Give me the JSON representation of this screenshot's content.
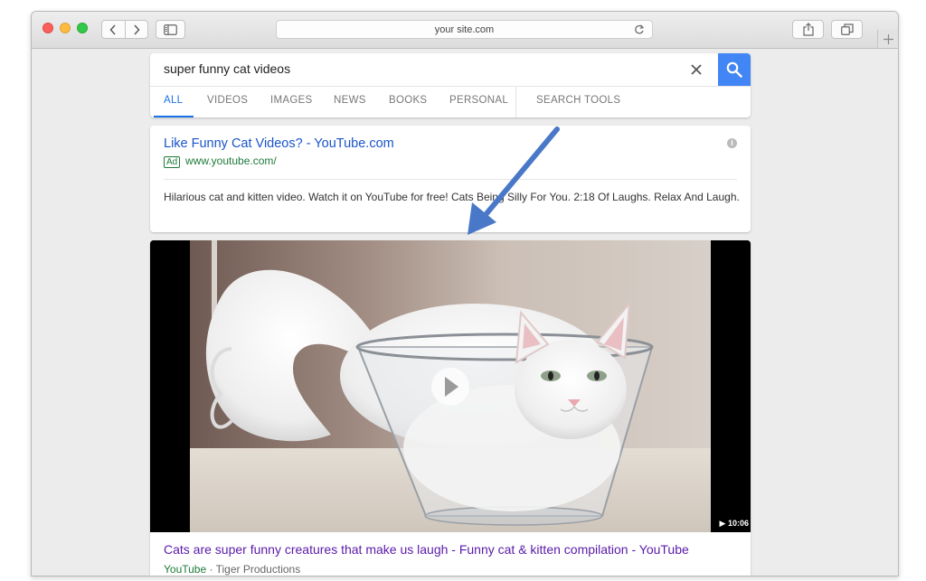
{
  "browser": {
    "url": "your site.com"
  },
  "search": {
    "query": "super funny cat videos",
    "tabs": [
      {
        "label": "ALL"
      },
      {
        "label": "VIDEOS"
      },
      {
        "label": "IMAGES"
      },
      {
        "label": "NEWS"
      },
      {
        "label": "BOOKS"
      },
      {
        "label": "PERSONAL"
      },
      {
        "label": "SEARCH TOOLS"
      }
    ]
  },
  "ad": {
    "title": "Like Funny Cat Videos? - YouTube.com",
    "badge": "Ad",
    "url": "www.youtube.com/",
    "description": "Hilarious cat and kitten video. Watch it on YouTube for free! Cats Being Silly For You. 2:18 Of Laughs. Relax And Laugh."
  },
  "video": {
    "duration": "▶ 10:06",
    "title": "Cats are super funny creatures that make us laugh - Funny cat & kitten compilation - YouTube",
    "source": "YouTube",
    "channel": " · Tiger Productions"
  },
  "colors": {
    "accent": "#4285f4",
    "annotation_arrow": "#4a78c8"
  }
}
